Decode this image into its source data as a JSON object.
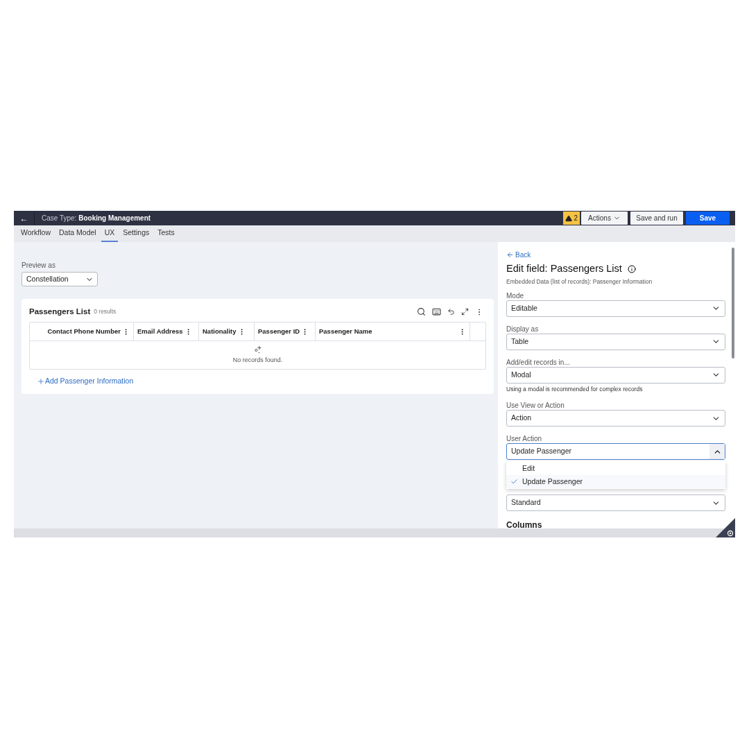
{
  "header": {
    "back": "←",
    "case_type_label": "Case Type:",
    "case_type_name": "Booking Management",
    "warning_count": "2",
    "buttons": [
      {
        "label": "Actions",
        "kind": "menu"
      },
      {
        "label": "Save and run",
        "kind": "secondary"
      },
      {
        "label": "Save",
        "kind": "primary"
      }
    ]
  },
  "tabs": [
    {
      "label": "Workflow",
      "selected": false
    },
    {
      "label": "Data Model",
      "selected": false
    },
    {
      "label": "UX",
      "selected": true
    },
    {
      "label": "Settings",
      "selected": false
    },
    {
      "label": "Tests",
      "selected": false
    }
  ],
  "preview": {
    "label": "Preview as",
    "value": "Constellation"
  },
  "list": {
    "title": "Passengers List",
    "count": "0 results",
    "columns": [
      {
        "label": "Contact Phone Number"
      },
      {
        "label": "Email Address"
      },
      {
        "label": "Nationality"
      },
      {
        "label": "Passenger ID"
      },
      {
        "label": "Passenger Name"
      }
    ],
    "empty": "No records found.",
    "add_link": "Add Passenger Information"
  },
  "panel": {
    "back": "Back",
    "title": "Edit field: Passengers List",
    "subtitle": "Embedded Data (list of records): Passenger Information",
    "fields": [
      {
        "label": "Mode",
        "value": "Editable",
        "open": false
      },
      {
        "label": "Display as",
        "value": "Table",
        "open": false
      },
      {
        "label": "Add/edit records in...",
        "value": "Modal",
        "hint": "Using a modal is recommended for complex records",
        "open": false
      },
      {
        "label": "Use View or Action",
        "value": "Action",
        "open": false
      },
      {
        "label": "User Action",
        "value": "Update Passenger",
        "open": true,
        "options": [
          {
            "label": "Edit",
            "selected": false
          },
          {
            "label": "Update Passenger",
            "selected": true
          }
        ]
      },
      {
        "value": "Standard",
        "open": false
      }
    ],
    "section": "Columns"
  }
}
